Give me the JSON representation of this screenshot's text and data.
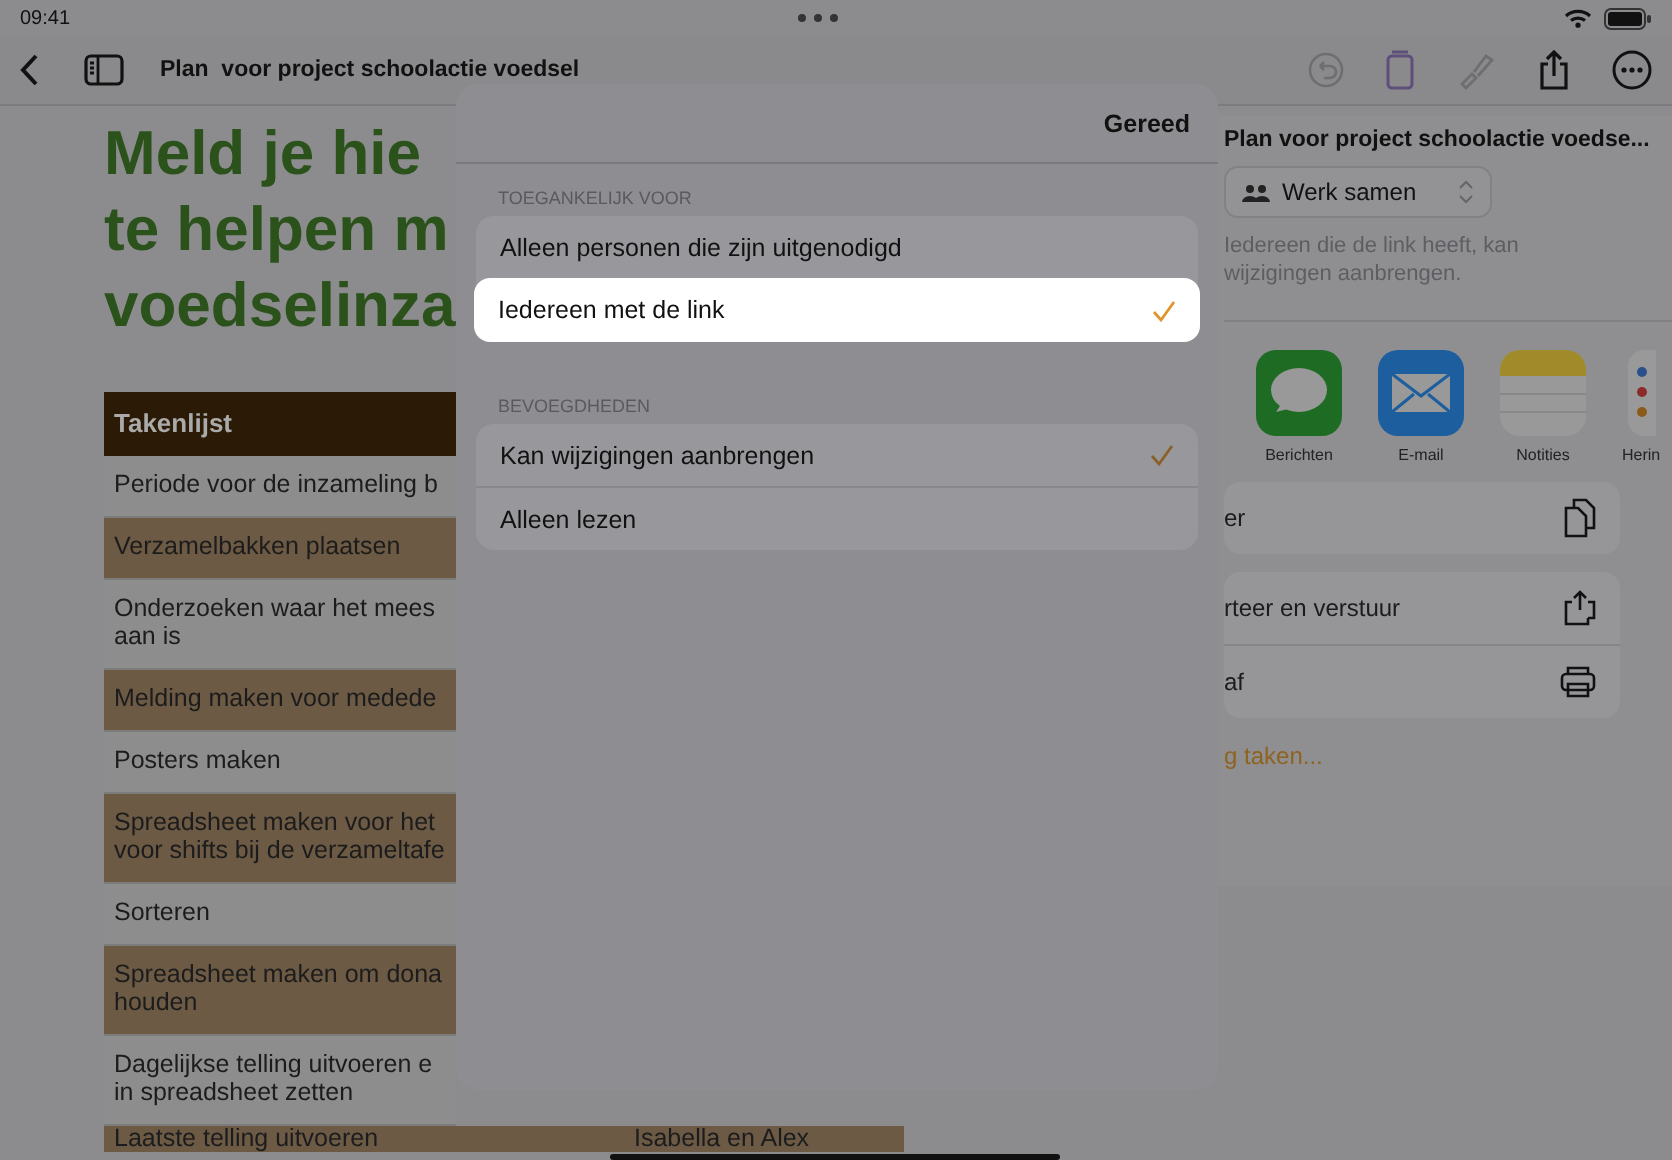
{
  "status_bar": {
    "time": "09:41"
  },
  "toolbar": {
    "title": "Plan  voor project schoolactie voedsel"
  },
  "document": {
    "heading_lines": [
      "Meld je hie",
      "te helpen m",
      "voedselinza"
    ],
    "table": {
      "header": "Takenlijst",
      "rows": [
        {
          "lines": [
            "Periode voor de inzameling b"
          ],
          "shaded": false
        },
        {
          "lines": [
            "Verzamelbakken plaatsen"
          ],
          "shaded": true
        },
        {
          "lines": [
            "Onderzoeken waar het mees",
            "aan is"
          ],
          "shaded": false
        },
        {
          "lines": [
            "Melding maken voor medede"
          ],
          "shaded": true
        },
        {
          "lines": [
            "Posters maken"
          ],
          "shaded": false
        },
        {
          "lines": [
            "Spreadsheet maken voor het",
            "voor shifts bij de verzameltafe"
          ],
          "shaded": true
        },
        {
          "lines": [
            "Sorteren"
          ],
          "shaded": false
        },
        {
          "lines": [
            "Spreadsheet maken om dona",
            "houden"
          ],
          "shaded": true
        },
        {
          "lines": [
            "Dagelijkse telling uitvoeren e",
            "in spreadsheet zetten"
          ],
          "shaded": false
        }
      ],
      "last_row": {
        "task": "Laatste telling uitvoeren",
        "owner": "Isabella en Alex"
      }
    }
  },
  "share_sheet": {
    "title": "Plan  voor project schoolactie voedse...",
    "mode_button": "Werk samen",
    "description": "Iedereen die de link heeft, kan wijzigingen aanbrengen.",
    "apps": [
      {
        "kind": "messages",
        "label": "Berichten"
      },
      {
        "kind": "mail",
        "label": "E-mail"
      },
      {
        "kind": "notes",
        "label": "Notities"
      },
      {
        "kind": "reminders",
        "label": "Herin"
      }
    ],
    "action_groups": [
      [
        {
          "kind": "copy",
          "label": "er"
        }
      ],
      [
        {
          "kind": "export",
          "label": "rteer en verstuur"
        },
        {
          "kind": "print",
          "label": "af"
        }
      ]
    ],
    "link": "g taken..."
  },
  "dialog": {
    "done": "Gereed",
    "sections": [
      {
        "title": "TOEGANKELIJK VOOR",
        "options": [
          {
            "label": "Alleen personen die zijn uitgenodigd",
            "selected": false,
            "highlighted": false
          },
          {
            "label": "Iedereen met de link",
            "selected": true,
            "highlighted": true
          }
        ]
      },
      {
        "title": "BEVOEGDHEDEN",
        "options": [
          {
            "label": "Kan wijzigingen aanbrengen",
            "selected": true,
            "highlighted": false
          },
          {
            "label": "Alleen lezen",
            "selected": false,
            "highlighted": false
          }
        ]
      }
    ]
  }
}
